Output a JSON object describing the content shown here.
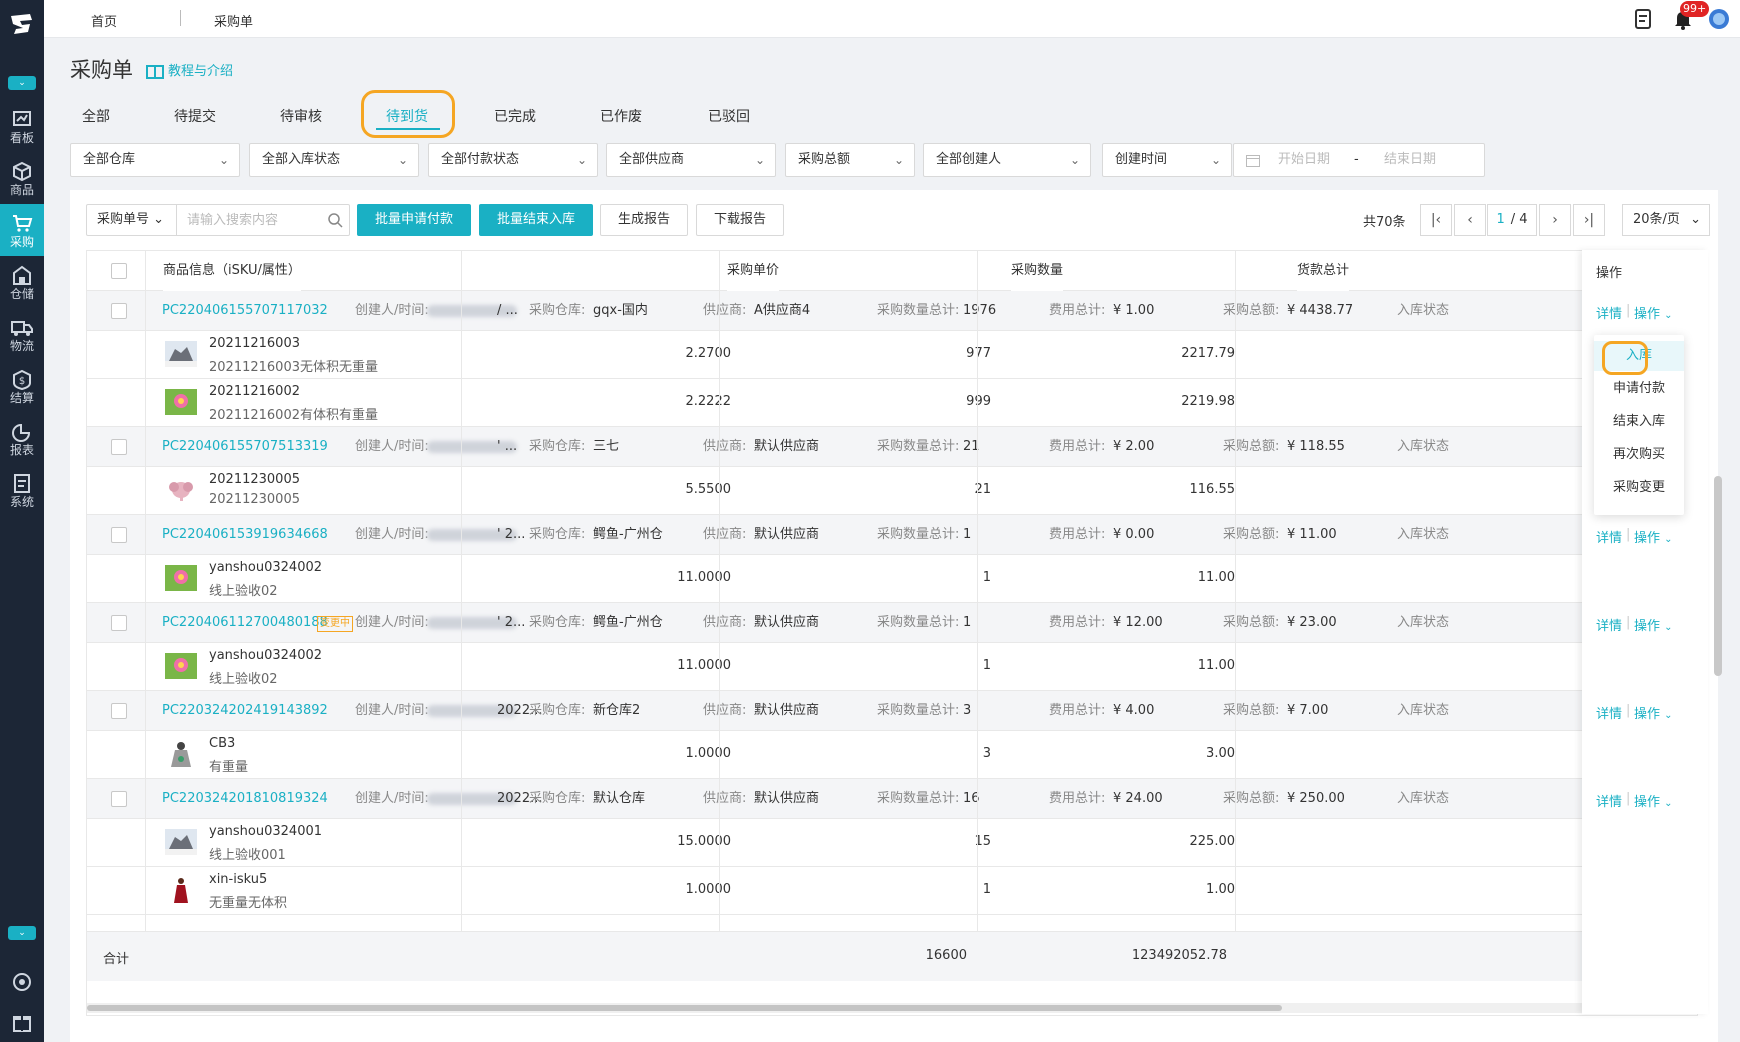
{
  "sidebar": {
    "items": [
      {
        "label": "看板",
        "icon": "dashboard-icon"
      },
      {
        "label": "商品",
        "icon": "cube-icon"
      },
      {
        "label": "采购",
        "icon": "cart-icon",
        "active": true
      },
      {
        "label": "仓储",
        "icon": "warehouse-icon"
      },
      {
        "label": "物流",
        "icon": "truck-icon"
      },
      {
        "label": "结算",
        "icon": "coin-icon"
      },
      {
        "label": "报表",
        "icon": "pie-chart-icon"
      },
      {
        "label": "系统",
        "icon": "system-icon"
      }
    ]
  },
  "topbar": {
    "breadcrumbs": [
      "首页",
      "采购单"
    ],
    "notification_badge": "99+"
  },
  "page": {
    "title": "采购单",
    "tutorial_link": "教程与介绍"
  },
  "tabs": [
    {
      "label": "全部"
    },
    {
      "label": "待提交"
    },
    {
      "label": "待审核"
    },
    {
      "label": "待到货",
      "active": true
    },
    {
      "label": "已完成"
    },
    {
      "label": "已作废"
    },
    {
      "label": "已驳回"
    }
  ],
  "filters": {
    "warehouse": "全部仓库",
    "inbound_status": "全部入库状态",
    "payment_status": "全部付款状态",
    "supplier": "全部供应商",
    "total_amount": "采购总额",
    "creator": "全部创建人",
    "time_type": "创建时间",
    "start_placeholder": "开始日期",
    "date_sep": "-",
    "end_placeholder": "结束日期"
  },
  "toolbar": {
    "search_field": "采购单号",
    "search_placeholder": "请输入搜索内容",
    "batch_pay": "批量申请付款",
    "batch_finish": "批量结束入库",
    "gen_report": "生成报告",
    "download_report": "下载报告"
  },
  "pager": {
    "total": "共70条",
    "current": "1",
    "pages": "/ 4",
    "page_size": "20条/页"
  },
  "table": {
    "headers": {
      "product": "商品信息（iSKU/属性）",
      "unit_price": "采购单价",
      "qty": "采购数量",
      "goods_total": "货款总计",
      "ops": "操作"
    },
    "labels": {
      "creator": "创建人/时间:",
      "warehouse": "采购仓库:",
      "supplier": "供应商:",
      "qty_total": "采购数量总计:",
      "fee_total": "费用总计:",
      "amount_total": "采购总额:",
      "inbound_status": "入库状态",
      "detail": "详情",
      "op": "操作",
      "change_tag": "变更中"
    },
    "orders": [
      {
        "id": "PC220406155707117032",
        "creator_tail": "/ ...",
        "warehouse": "gqx-国内",
        "supplier": "A供应商4",
        "qty_total": "1976",
        "fee_total": "¥ 1.00",
        "amount_total": "¥ 4438.77",
        "changing": false,
        "items": [
          {
            "sku": "20211216003",
            "attr": "20211216003无体积无重量",
            "price": "2.2700",
            "qty": "977",
            "total": "2217.79",
            "thumb": "wolf"
          },
          {
            "sku": "20211216002",
            "attr": "20211216002有体积有重量",
            "price": "2.2222",
            "qty": "999",
            "total": "2219.98",
            "thumb": "flower"
          }
        ]
      },
      {
        "id": "PC220406155707513319",
        "creator_tail": "' ...",
        "warehouse": "三七",
        "supplier": "默认供应商",
        "qty_total": "21",
        "fee_total": "¥ 2.00",
        "amount_total": "¥ 118.55",
        "changing": false,
        "items": [
          {
            "sku": "20211230005",
            "attr": "20211230005",
            "price": "5.5500",
            "qty": "21",
            "total": "116.55",
            "thumb": "elephant"
          }
        ]
      },
      {
        "id": "PC220406153919634668",
        "creator_tail": "' 2...",
        "warehouse": "鳄鱼-广州仓",
        "supplier": "默认供应商",
        "qty_total": "1",
        "fee_total": "¥ 0.00",
        "amount_total": "¥ 11.00",
        "changing": false,
        "items": [
          {
            "sku": "yanshou0324002",
            "attr": "线上验收02",
            "price": "11.0000",
            "qty": "1",
            "total": "11.00",
            "thumb": "flower"
          }
        ]
      },
      {
        "id": "PC220406112700480188",
        "creator_tail": "' 2...",
        "warehouse": "鳄鱼-广州仓",
        "supplier": "默认供应商",
        "qty_total": "1",
        "fee_total": "¥ 12.00",
        "amount_total": "¥ 23.00",
        "changing": true,
        "items": [
          {
            "sku": "yanshou0324002",
            "attr": "线上验收02",
            "price": "11.0000",
            "qty": "1",
            "total": "11.00",
            "thumb": "flower"
          }
        ]
      },
      {
        "id": "PC220324202419143892",
        "creator_tail": "2022...",
        "warehouse": "新仓库2",
        "supplier": "默认供应商",
        "qty_total": "3",
        "fee_total": "¥ 4.00",
        "amount_total": "¥ 7.00",
        "changing": false,
        "items": [
          {
            "sku": "CB3",
            "attr": "有重量",
            "price": "1.0000",
            "qty": "3",
            "total": "3.00",
            "thumb": "dress"
          }
        ]
      },
      {
        "id": "PC220324201810819324",
        "creator_tail": "2022...",
        "warehouse": "默认仓库",
        "supplier": "默认供应商",
        "qty_total": "16",
        "fee_total": "¥ 24.00",
        "amount_total": "¥ 250.00",
        "changing": false,
        "items": [
          {
            "sku": "yanshou0324001",
            "attr": "线上验收001",
            "price": "15.0000",
            "qty": "15",
            "total": "225.00",
            "thumb": "wolf"
          },
          {
            "sku": "xin-isku5",
            "attr": "无重量无体积",
            "price": "1.0000",
            "qty": "1",
            "total": "1.00",
            "thumb": "red-dress"
          }
        ]
      }
    ],
    "footer": {
      "label": "合计",
      "qty": "16600",
      "amount": "123492052.78"
    }
  },
  "op_menu": {
    "items": [
      "入库",
      "申请付款",
      "结束入库",
      "再次购买",
      "采购变更"
    ]
  },
  "colors": {
    "accent": "#1ab0c4",
    "sidebar_bg": "#1c2636",
    "highlight_ring": "#f5a623",
    "badge": "#e02424"
  }
}
